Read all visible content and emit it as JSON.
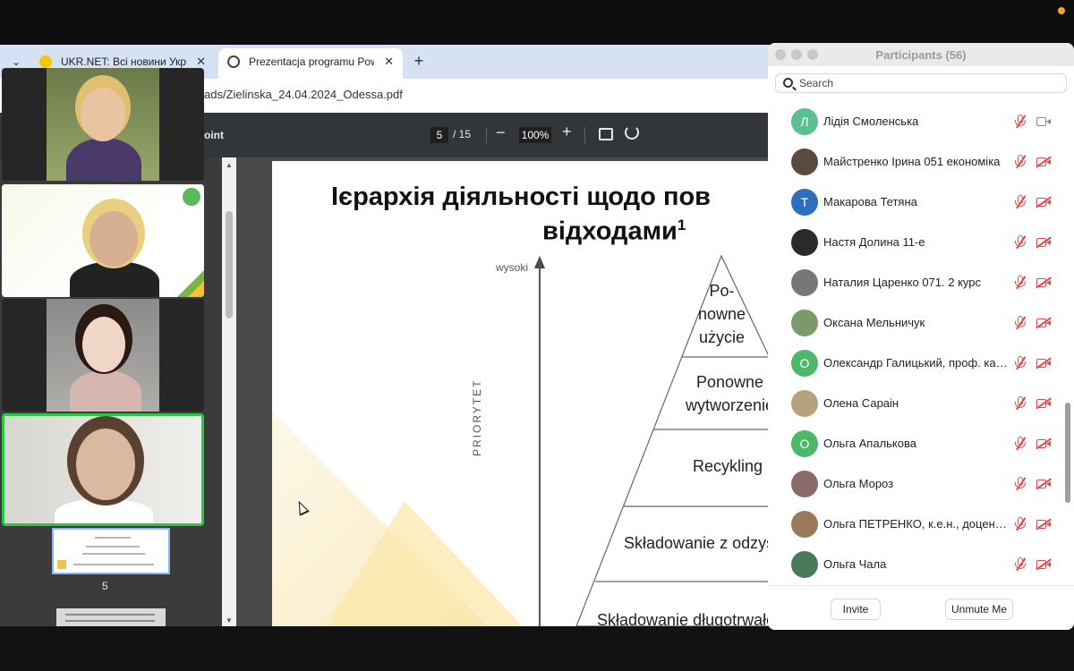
{
  "browser": {
    "tabs": [
      {
        "label": "UKR.NET: Всі новини України",
        "active": false
      },
      {
        "label": "Prezentacja programu PowerPoint",
        "active": true
      }
    ],
    "new_tab": "+",
    "close": "✕",
    "url": "ads/Zielinska_24.04.2024_Odessa.pdf"
  },
  "pdf": {
    "title": "oint",
    "page_current": "5",
    "page_total": "/ 15",
    "zoom": "100%",
    "thumb_number": "5"
  },
  "slide": {
    "title_line1": "Ієрархія діяльності щодо пов",
    "title_line2": "відходами",
    "title_sup": "1",
    "axis_top": "wysoki",
    "axis_side": "PRIORYTET",
    "pyramid_levels": [
      "Po-\nnowne\nużycie",
      "Ponowne\nwytworzenie",
      "Recykling",
      "Składowanie z odzyskie",
      "Składowanie długotrwałe ne"
    ]
  },
  "participants": {
    "title": "Participants (56)",
    "search_placeholder": "Search",
    "list": [
      {
        "name": "Лідія Смоленська",
        "avatar_letter": "Л",
        "avatar_color": "#5bbf8f",
        "camera_on": true
      },
      {
        "name": "Майстренко Ірина 051 економіка",
        "avatar_letter": "",
        "avatar_color": "#5a4a40",
        "camera_on": false
      },
      {
        "name": "Макарова Тетяна",
        "avatar_letter": "Т",
        "avatar_color": "#2e6fbd",
        "camera_on": false
      },
      {
        "name": "Настя Долина 11-е",
        "avatar_letter": "",
        "avatar_color": "#2a2a2a",
        "camera_on": false
      },
      {
        "name": "Наталия Царенко 071. 2 курс",
        "avatar_letter": "",
        "avatar_color": "#777777",
        "camera_on": false
      },
      {
        "name": "Оксана Мельничук",
        "avatar_letter": "",
        "avatar_color": "#7a9a6a",
        "camera_on": false
      },
      {
        "name": "Олександр Галицький, проф. кафедри",
        "avatar_letter": "О",
        "avatar_color": "#4cb86a",
        "camera_on": false
      },
      {
        "name": "Олена Сараін",
        "avatar_letter": "",
        "avatar_color": "#b5a380",
        "camera_on": false
      },
      {
        "name": "Ольга Апалькова",
        "avatar_letter": "О",
        "avatar_color": "#4cb86a",
        "camera_on": false
      },
      {
        "name": "Ольга Мороз",
        "avatar_letter": "",
        "avatar_color": "#8a6a6a",
        "camera_on": false
      },
      {
        "name": "Ольга ПЕТРЕНКО, к.е.н., доцент кафедри",
        "avatar_letter": "",
        "avatar_color": "#9a7a5a",
        "camera_on": false
      },
      {
        "name": "Ольга Чала",
        "avatar_letter": "",
        "avatar_color": "#4a7a5a",
        "camera_on": false
      }
    ],
    "invite_label": "Invite",
    "unmute_label": "Unmute Me"
  },
  "colors": {
    "accent_green": "#27c93f",
    "muted_red": "#e04a4a",
    "recording_dot": "#f6a623"
  }
}
